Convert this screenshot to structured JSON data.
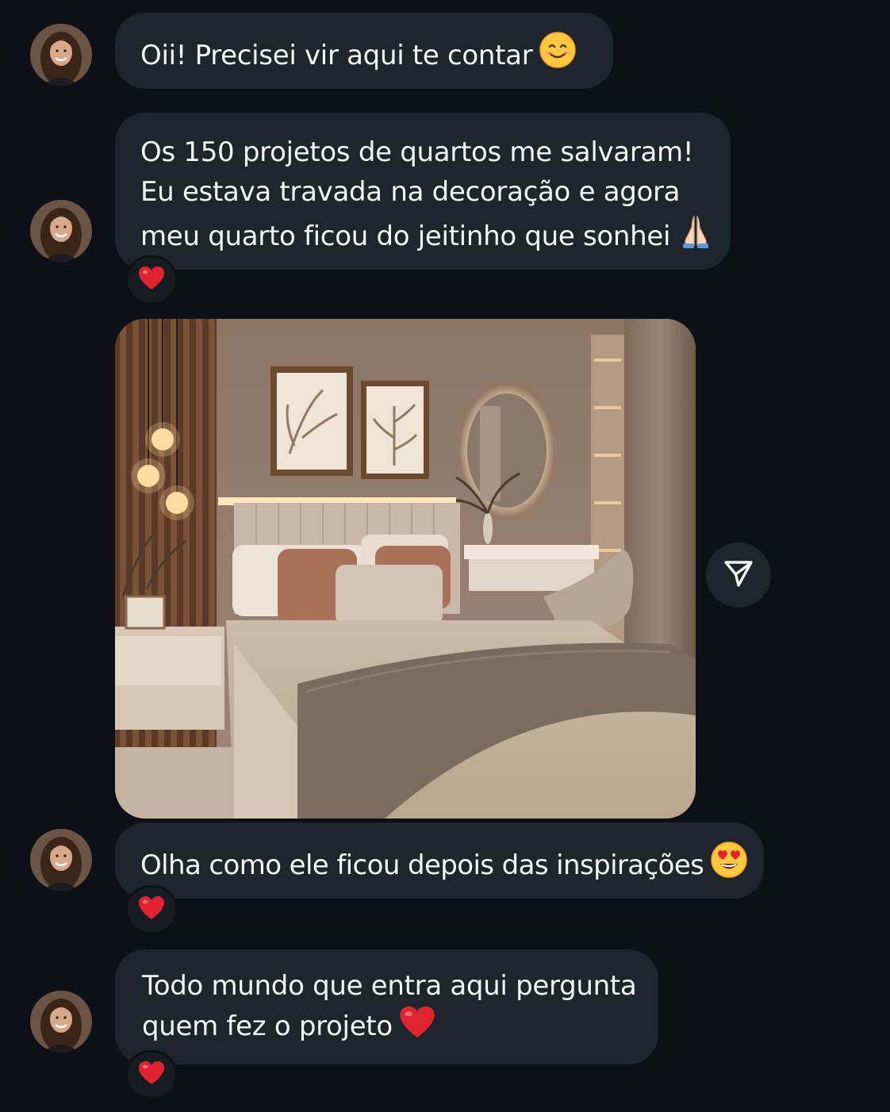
{
  "messages": [
    {
      "id": "m1",
      "lines": [
        "Oii! Precisei vir aqui te contar"
      ],
      "emoji": "smiling-face-emoji"
    },
    {
      "id": "m2",
      "lines": [
        "Os 150 projetos de quartos me salvaram!",
        "Eu estava travada na decoração e agora",
        "meu quarto ficou do jeitinho que sonhei"
      ],
      "emoji": "folded-hands-emoji",
      "reaction": "red-heart-emoji"
    },
    {
      "id": "m3",
      "type": "image",
      "image": "bedroom-photo"
    },
    {
      "id": "m4",
      "lines": [
        "Olha como ele ficou depois das inspirações"
      ],
      "emoji": "heart-eyes-emoji",
      "reaction": "red-heart-emoji"
    },
    {
      "id": "m5",
      "lines": [
        "Todo mundo que entra aqui pergunta",
        "quem fez o projeto"
      ],
      "emoji": "red-heart-emoji",
      "reaction": "red-heart-emoji"
    }
  ],
  "share": {
    "icon": "paper-plane-icon"
  },
  "colors": {
    "background": "#0d1117",
    "bubble": "#1f252c",
    "text": "#f3f4f6",
    "heart": "#e0242f"
  }
}
